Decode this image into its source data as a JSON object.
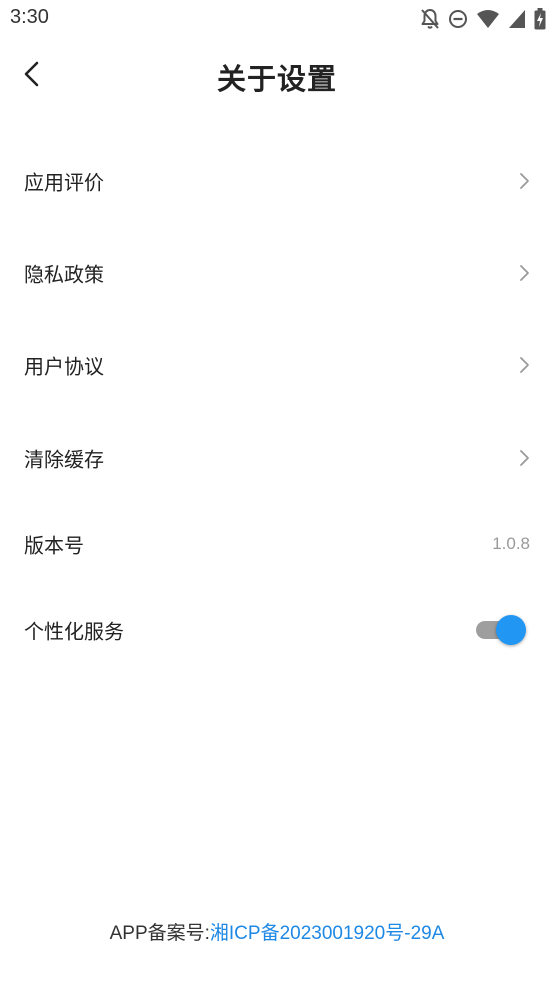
{
  "status_bar": {
    "time": "3:30",
    "icons": [
      "notifications-off-icon",
      "do-not-disturb-icon",
      "wifi-icon",
      "cellular-signal-icon",
      "battery-charging-icon"
    ]
  },
  "header": {
    "back_icon": "back-arrow-icon",
    "title": "关于设置"
  },
  "settings": {
    "items": [
      {
        "label": "应用评价",
        "type": "link"
      },
      {
        "label": "隐私政策",
        "type": "link"
      },
      {
        "label": "用户协议",
        "type": "link"
      },
      {
        "label": "清除缓存",
        "type": "link"
      },
      {
        "label": "版本号",
        "type": "value",
        "value": "1.0.8"
      },
      {
        "label": "个性化服务",
        "type": "toggle",
        "enabled": true
      }
    ]
  },
  "footer": {
    "prefix": "APP备案号:",
    "link_text": "湘ICP备2023001920号-29A"
  },
  "colors": {
    "accent": "#2196f3",
    "link": "#1e88e5",
    "text": "#222222",
    "secondary_text": "#9a9a9a",
    "toggle_track": "#9e9e9e"
  }
}
